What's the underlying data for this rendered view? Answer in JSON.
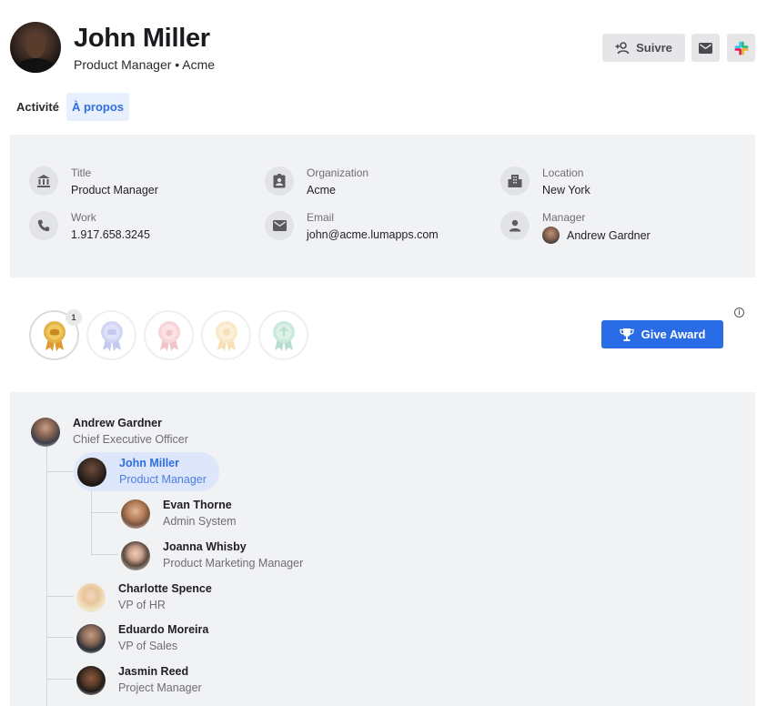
{
  "profile": {
    "name": "John Miller",
    "subtitle": "Product Manager • Acme"
  },
  "header_actions": {
    "follow_label": "Suivre",
    "mail_icon": "mail-icon",
    "slack_icon": "slack-icon",
    "follow_icon": "person-add-icon"
  },
  "tabs": [
    {
      "label": "Activité",
      "active": false
    },
    {
      "label": "À propos",
      "active": true
    }
  ],
  "info": {
    "title": {
      "label": "Title",
      "value": "Product Manager",
      "icon": "bank-icon"
    },
    "organization": {
      "label": "Organization",
      "value": "Acme",
      "icon": "badge-icon"
    },
    "location": {
      "label": "Location",
      "value": "New York",
      "icon": "city-icon"
    },
    "work": {
      "label": "Work",
      "value": "1.917.658.3245",
      "icon": "phone-icon"
    },
    "email": {
      "label": "Email",
      "value": "john@acme.lumapps.com",
      "icon": "mail-icon"
    },
    "manager": {
      "label": "Manager",
      "value": "Andrew Gardner",
      "icon": "person-icon"
    }
  },
  "awards": {
    "count_first": "1",
    "button_label": "Give Award",
    "button_icon": "trophy-icon",
    "info_glyph": "i"
  },
  "org_chart": {
    "root": {
      "name": "Andrew Gardner",
      "role": "Chief Executive Officer"
    },
    "selected": {
      "name": "John Miller",
      "role": "Product Manager"
    },
    "reports": [
      {
        "name": "Evan Thorne",
        "role": "Admin System"
      },
      {
        "name": "Joanna Whisby",
        "role": "Product Marketing Manager"
      }
    ],
    "peers": [
      {
        "name": "Charlotte Spence",
        "role": "VP of HR"
      },
      {
        "name": "Eduardo Moreira",
        "role": "VP of Sales"
      },
      {
        "name": "Jasmin Reed",
        "role": "Project Manager"
      }
    ]
  },
  "colors": {
    "accent": "#2a6be6",
    "tab_active_bg": "#e8effd",
    "card_bg": "#f1f2f4",
    "award_gold": "#e4b44a",
    "award_blue": "#9aa6e8",
    "award_pink": "#f0a3ad",
    "award_yellow": "#f5d08a",
    "award_green": "#8fd0b6"
  }
}
